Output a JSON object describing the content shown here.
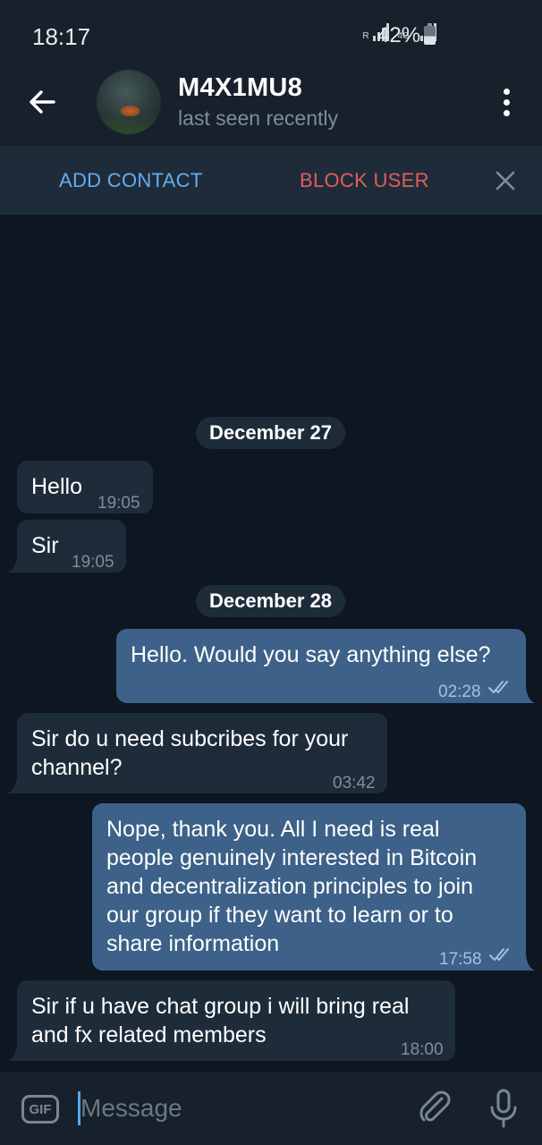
{
  "status_bar": {
    "time": "18:17",
    "network_label_1": "R",
    "network_label_2": "4G",
    "battery": "42%",
    "battery_level": 0.42
  },
  "header": {
    "back_icon": "arrow-left-icon",
    "name": "M4X1MU8",
    "status": "last seen recently",
    "menu_icon": "more-vertical-icon"
  },
  "action_bar": {
    "add_contact": "ADD CONTACT",
    "block_user": "BLOCK USER",
    "close_icon": "close-icon"
  },
  "chat": {
    "dates": [
      "December 27",
      "December 28"
    ],
    "messages": [
      {
        "direction": "in",
        "text": "Hello",
        "time": "19:05"
      },
      {
        "direction": "in",
        "text": "Sir",
        "time": "19:05"
      },
      {
        "direction": "out",
        "text": "Hello. Would you say anything else?",
        "time": "02:28",
        "read": true
      },
      {
        "direction": "in",
        "text": "Sir do u need subcribes for your\nchannel?",
        "time": "03:42"
      },
      {
        "direction": "out",
        "text": "Nope, thank you. All I need is real\npeople genuinely interested in Bitcoin\nand decentralization principles to join\nour group if they want to learn or to\nshare information",
        "time": "17:58",
        "read": true
      },
      {
        "direction": "in",
        "text": "Sir if u have chat group i will bring real\nand fx related members",
        "time": "18:00"
      }
    ]
  },
  "input_bar": {
    "gif_label": "GIF",
    "placeholder": "Message",
    "attach_icon": "paperclip-icon",
    "mic_icon": "microphone-icon"
  },
  "colors": {
    "background": "#0e1621",
    "header": "#17212b",
    "incoming_bubble": "#1e2c3a",
    "outgoing_bubble": "#3d6188",
    "accent_blue": "#62aef0",
    "danger_red": "#e25d5d"
  }
}
